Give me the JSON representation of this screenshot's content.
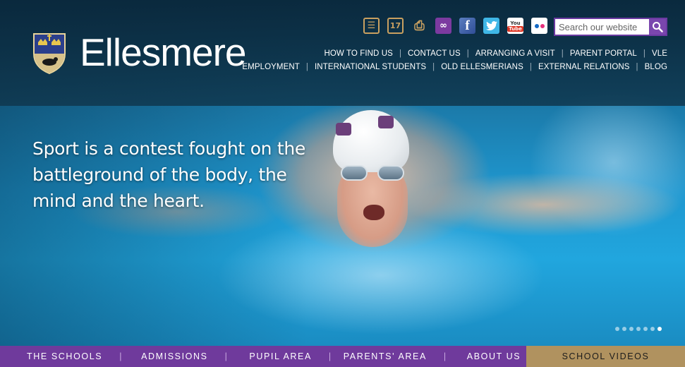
{
  "brand": {
    "name": "Ellesmere",
    "crest_icon": "school-crest-icon"
  },
  "utility_icons": [
    {
      "name": "news-icon",
      "glyph": "☰"
    },
    {
      "name": "calendar-icon",
      "glyph": "17"
    },
    {
      "name": "print-icon",
      "glyph": "⎙"
    },
    {
      "name": "link-icon",
      "glyph": "∞"
    },
    {
      "name": "facebook-icon",
      "glyph": "f"
    },
    {
      "name": "twitter-icon",
      "glyph": "🐦"
    },
    {
      "name": "youtube-icon",
      "glyph": "You"
    },
    {
      "name": "flickr-icon",
      "glyph": ""
    }
  ],
  "search": {
    "placeholder": "Search our website",
    "icon": "search-icon"
  },
  "top_nav": {
    "row1": [
      "HOW TO FIND US",
      "CONTACT US",
      "ARRANGING A VISIT",
      "PARENT PORTAL",
      "VLE"
    ],
    "row2": [
      "EMPLOYMENT",
      "INTERNATIONAL STUDENTS",
      "OLD ELLESMERIANS",
      "EXTERNAL RELATIONS",
      "BLOG"
    ]
  },
  "hero": {
    "quote": "Sport is a contest fought on the battleground of the body, the mind and the heart.",
    "slide_count": 7,
    "active_slide": 7
  },
  "bottom_nav": {
    "items": [
      "THE SCHOOLS",
      "ADMISSIONS",
      "PUPIL AREA",
      "PARENTS' AREA",
      "ABOUT US"
    ],
    "highlight": "SCHOOL VIDEOS"
  },
  "colors": {
    "purple": "#6f3a9c",
    "gold": "#b0925f",
    "header_bg": "#0f374e"
  }
}
